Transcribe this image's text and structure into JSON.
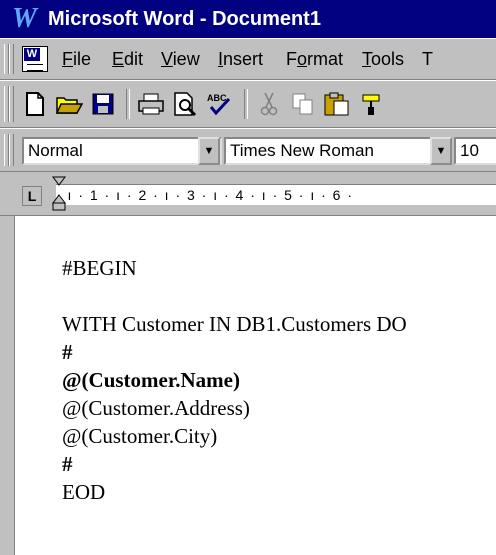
{
  "window": {
    "title": "Microsoft Word - Document1",
    "app_icon": "word-icon"
  },
  "menu": [
    "File",
    "Edit",
    "View",
    "Insert",
    "Format",
    "Tools",
    "T"
  ],
  "toolbar": {
    "buttons": [
      "new-icon",
      "open-icon",
      "save-icon",
      "print-icon",
      "print-preview-icon",
      "spelling-icon",
      "cut-icon",
      "copy-icon",
      "paste-icon",
      "format-painter-icon"
    ]
  },
  "format": {
    "style": "Normal",
    "font": "Times New Roman",
    "size": "10"
  },
  "ruler": {
    "tab_selector": "L",
    "marks": "· ı · 1 · ı · 2 · ı · 3 · ı · 4 · ı · 5 · ı · 6 ·"
  },
  "document": {
    "lines": [
      {
        "text": "#BEGIN",
        "bold": false
      },
      {
        "text": "",
        "bold": false
      },
      {
        "text": "WITH Customer IN DB1.Customers DO",
        "bold": false
      },
      {
        "text": "#",
        "bold": true
      },
      {
        "text": "@(Customer.Name)",
        "bold": true
      },
      {
        "text": "@(Customer.Address)",
        "bold": false
      },
      {
        "text": "@(Customer.City)",
        "bold": false
      },
      {
        "text": "#",
        "bold": true
      },
      {
        "text": "EOD",
        "bold": false
      }
    ]
  }
}
